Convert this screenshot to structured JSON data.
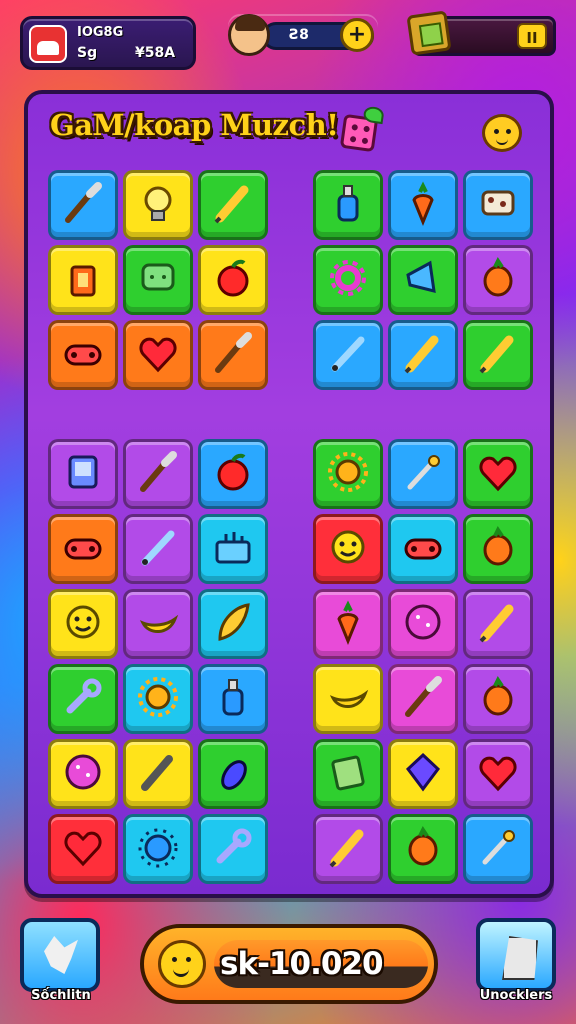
{
  "hud": {
    "profile_name": "IOG8G",
    "profile_level": "Sg",
    "profile_score": "¥58A",
    "lives_value": "Ƨ8",
    "pause_label": "II"
  },
  "board": {
    "title": "GaM/koap Muzch!"
  },
  "colors": {
    "blue": "#2aa8ff",
    "yellow": "#ffe31a",
    "green": "#2fcf2f",
    "orange": "#ff7a1a",
    "purple": "#b24be8",
    "red": "#ff2f3a",
    "cyan": "#1fc8f0",
    "magenta": "#e84bd8",
    "lime": "#66d21a"
  },
  "grids": [
    {
      "name": "top-left",
      "tiles": [
        {
          "color": "blue",
          "icon": "brush-icon"
        },
        {
          "color": "yellow",
          "icon": "lightbulb-icon"
        },
        {
          "color": "green",
          "icon": "pencil-icon"
        },
        {
          "color": "yellow",
          "icon": "lantern-icon"
        },
        {
          "color": "green",
          "icon": "chat-icon"
        },
        {
          "color": "yellow",
          "icon": "apple-icon"
        },
        {
          "color": "orange",
          "icon": "gamepad-icon"
        },
        {
          "color": "orange",
          "icon": "heart-icon"
        },
        {
          "color": "orange",
          "icon": "brush-icon"
        }
      ]
    },
    {
      "name": "top-right",
      "tiles": [
        {
          "color": "green",
          "icon": "bottle-icon"
        },
        {
          "color": "blue",
          "icon": "carrot-icon"
        },
        {
          "color": "blue",
          "icon": "cookie-icon"
        },
        {
          "color": "green",
          "icon": "gear-icon"
        },
        {
          "color": "green",
          "icon": "megaphone-icon"
        },
        {
          "color": "purple",
          "icon": "fruit-icon"
        },
        {
          "color": "blue",
          "icon": "pen-icon"
        },
        {
          "color": "blue",
          "icon": "pencil-icon"
        },
        {
          "color": "green",
          "icon": "pencil-icon"
        }
      ]
    },
    {
      "name": "bottom-left",
      "tiles": [
        {
          "color": "purple",
          "icon": "device-icon"
        },
        {
          "color": "purple",
          "icon": "brush-icon"
        },
        {
          "color": "blue",
          "icon": "apple-icon"
        },
        {
          "color": "orange",
          "icon": "gamepad-icon"
        },
        {
          "color": "purple",
          "icon": "pen-icon"
        },
        {
          "color": "cyan",
          "icon": "toolbox-icon"
        },
        {
          "color": "yellow",
          "icon": "smiley-icon"
        },
        {
          "color": "purple",
          "icon": "banana-icon"
        },
        {
          "color": "cyan",
          "icon": "leaf-icon"
        },
        {
          "color": "green",
          "icon": "wrench-icon"
        },
        {
          "color": "cyan",
          "icon": "sun-icon"
        },
        {
          "color": "blue",
          "icon": "bottle-icon"
        },
        {
          "color": "yellow",
          "icon": "ball-icon"
        },
        {
          "color": "yellow",
          "icon": "bat-icon"
        },
        {
          "color": "green",
          "icon": "eggplant-icon"
        },
        {
          "color": "red",
          "icon": "heart-icon"
        },
        {
          "color": "cyan",
          "icon": "spiky-icon"
        },
        {
          "color": "cyan",
          "icon": "wrench-icon"
        }
      ]
    },
    {
      "name": "bottom-right",
      "tiles": [
        {
          "color": "green",
          "icon": "sun-icon"
        },
        {
          "color": "blue",
          "icon": "wand-icon"
        },
        {
          "color": "green",
          "icon": "heart-icon"
        },
        {
          "color": "red",
          "icon": "smiley-icon"
        },
        {
          "color": "cyan",
          "icon": "gamepad-icon"
        },
        {
          "color": "green",
          "icon": "fruit-icon"
        },
        {
          "color": "magenta",
          "icon": "carrot-icon"
        },
        {
          "color": "magenta",
          "icon": "ball-icon"
        },
        {
          "color": "purple",
          "icon": "pencil-icon"
        },
        {
          "color": "yellow",
          "icon": "banana-icon"
        },
        {
          "color": "magenta",
          "icon": "brush-icon"
        },
        {
          "color": "purple",
          "icon": "fruit-icon"
        },
        {
          "color": "green",
          "icon": "note-icon"
        },
        {
          "color": "yellow",
          "icon": "gem-icon"
        },
        {
          "color": "purple",
          "icon": "heart-icon"
        },
        {
          "color": "purple",
          "icon": "pencil-icon"
        },
        {
          "color": "green",
          "icon": "fruit-icon"
        },
        {
          "color": "blue",
          "icon": "wand-icon"
        }
      ]
    }
  ],
  "footer": {
    "left_label": "Sốchlitn",
    "score_text": "sk-10.020",
    "right_label": "Unocklers"
  }
}
